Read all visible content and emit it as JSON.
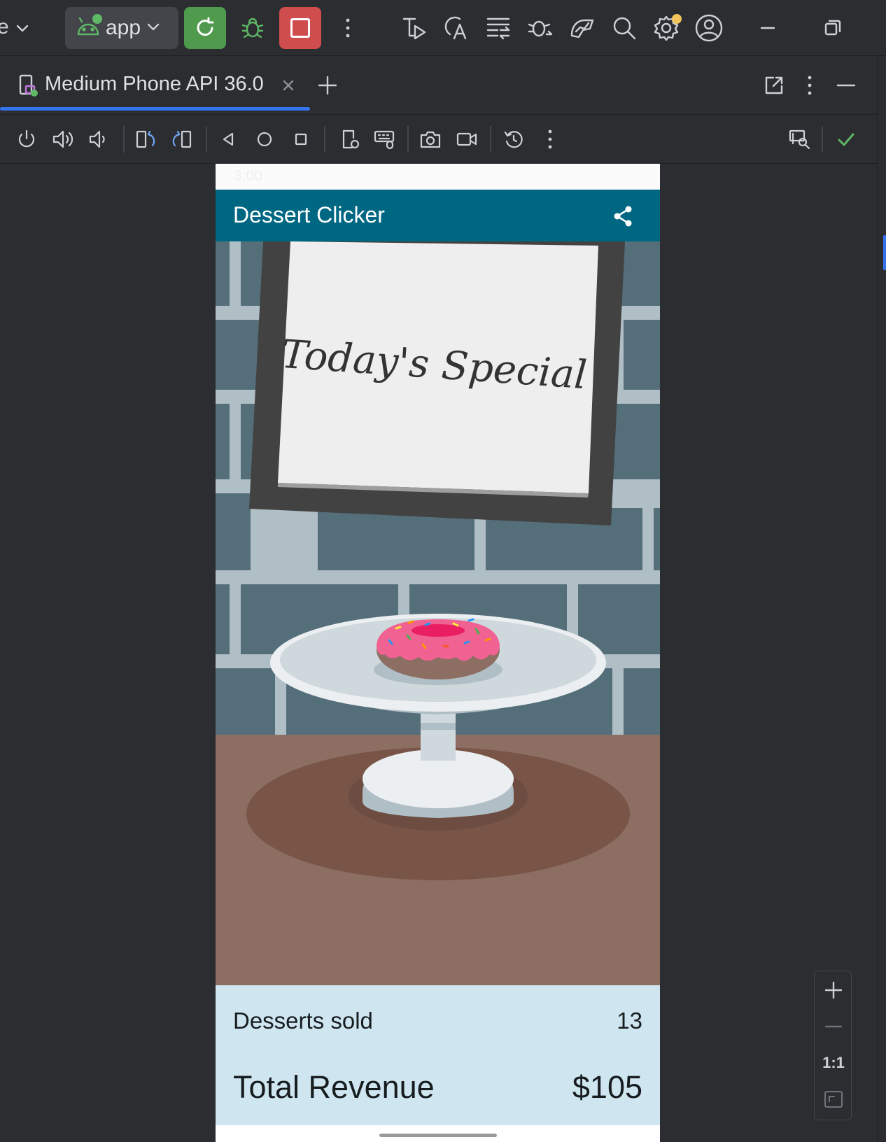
{
  "ide": {
    "partial_label": "e",
    "run_config": "app"
  },
  "tab": {
    "label": "Medium Phone API 36.0"
  },
  "phone": {
    "app_title": "Dessert Clicker",
    "status_time": "3:00",
    "scene_sign_text": "Today's Special",
    "stats": {
      "desserts_sold_label": "Desserts sold",
      "desserts_sold_value": "13",
      "revenue_label": "Total Revenue",
      "revenue_value": "$105"
    }
  },
  "zoom": {
    "actual_size_label": "1:1"
  },
  "colors": {
    "app_bar": "#006783",
    "stats_bg": "#cfe6f1",
    "run_green": "#4f9a4c",
    "stop_red": "#d04d4d",
    "accent_blue": "#3574f0"
  }
}
